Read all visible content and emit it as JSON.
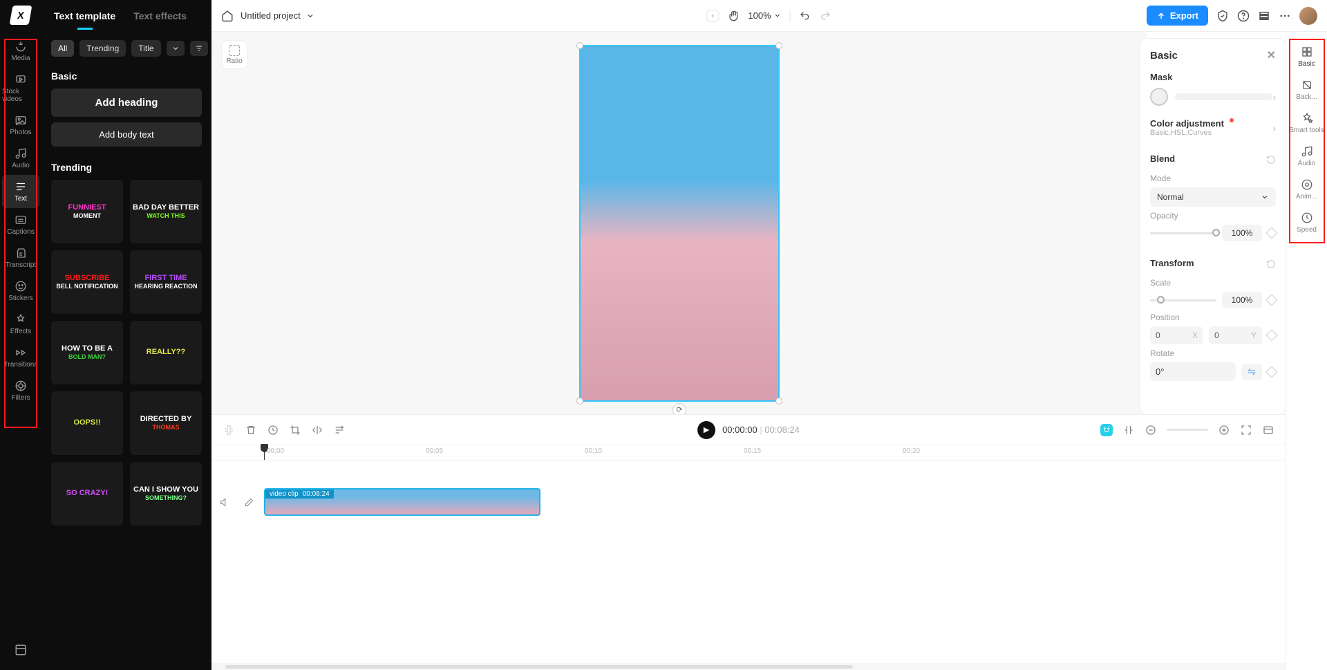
{
  "project": {
    "name": "Untitled project"
  },
  "topbar": {
    "zoom": "100%",
    "export": "Export"
  },
  "leftnav": {
    "items": [
      {
        "label": "Media"
      },
      {
        "label": "Stock videos"
      },
      {
        "label": "Photos"
      },
      {
        "label": "Audio"
      },
      {
        "label": "Text"
      },
      {
        "label": "Captions"
      },
      {
        "label": "Transcript"
      },
      {
        "label": "Stickers"
      },
      {
        "label": "Effects"
      },
      {
        "label": "Transitions"
      },
      {
        "label": "Filters"
      }
    ]
  },
  "leftpanel": {
    "tabs": {
      "template": "Text template",
      "effects": "Text effects"
    },
    "filters": {
      "all": "All",
      "trending": "Trending",
      "title": "Title"
    },
    "basic": {
      "heading": "Basic",
      "add_heading": "Add heading",
      "add_body": "Add body text"
    },
    "trending": {
      "heading": "Trending",
      "items": [
        {
          "l1": "FUNNIEST",
          "l2": "MOMENT",
          "c1": "#ff33cc",
          "c2": "#ffffff"
        },
        {
          "l1": "BAD DAY BETTER",
          "l2": "WATCH THIS",
          "c1": "#ffffff",
          "c2": "#7cff1a"
        },
        {
          "l1": "SUBSCRIBE",
          "l2": "BELL NOTIFICATION",
          "c1": "#ff1a1a",
          "c2": "#ffffff"
        },
        {
          "l1": "FIRST TIME",
          "l2": "HEARING REACTION",
          "c1": "#b84dff",
          "c2": "#ffffff"
        },
        {
          "l1": "HOW TO BE A",
          "l2": "BOLD MAN?",
          "c1": "#ffffff",
          "c2": "#3bd13b"
        },
        {
          "l1": "REALLY??",
          "l2": "",
          "c1": "#e8e84a",
          "c2": ""
        },
        {
          "l1": "OOPS!!",
          "l2": "",
          "c1": "#d9e84a",
          "c2": ""
        },
        {
          "l1": "DIRECTED BY",
          "l2": "THOMAS",
          "c1": "#ffffff",
          "c2": "#ff3b1a"
        },
        {
          "l1": "SO CRAZY!",
          "l2": "",
          "c1": "#d64dff",
          "c2": ""
        },
        {
          "l1": "CAN I SHOW YOU",
          "l2": "SOMETHING?",
          "c1": "#ffffff",
          "c2": "#7cff8a"
        }
      ]
    }
  },
  "canvas": {
    "ratio": "Ratio"
  },
  "inspector": {
    "title": "Basic",
    "mask": {
      "label": "Mask"
    },
    "color": {
      "label": "Color adjustment",
      "sub": "Basic,HSL,Curves"
    },
    "blend": {
      "label": "Blend",
      "mode_label": "Mode",
      "mode": "Normal",
      "opacity_label": "Opacity",
      "opacity": "100%"
    },
    "transform": {
      "label": "Transform",
      "scale_label": "Scale",
      "scale": "100%",
      "position_label": "Position",
      "x": "0",
      "y": "0",
      "rotate_label": "Rotate",
      "rotate": "0°"
    }
  },
  "rightrail": {
    "items": [
      {
        "label": "Basic"
      },
      {
        "label": "Back..."
      },
      {
        "label": "Smart tools"
      },
      {
        "label": "Audio"
      },
      {
        "label": "Anim..."
      },
      {
        "label": "Speed"
      }
    ]
  },
  "timeline": {
    "current": "00:00:00",
    "duration": "00:08:24",
    "ticks": [
      "00:00",
      "00:05",
      "00:10",
      "00:15",
      "00:20"
    ],
    "clip": {
      "name": "video clip",
      "dur": "00:08:24"
    }
  }
}
